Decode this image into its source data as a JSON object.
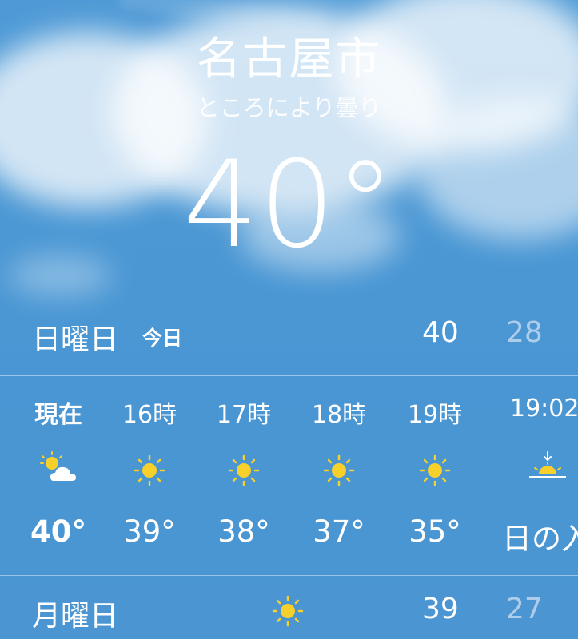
{
  "location": {
    "city": "名古屋市",
    "condition": "ところにより曇り",
    "temperature": "40°"
  },
  "today": {
    "day": "日曜日",
    "tag": "今日",
    "high": "40",
    "low": "28"
  },
  "hourly": [
    {
      "time": "現在",
      "icon": "partly-cloudy-icon",
      "temp": "40°"
    },
    {
      "time": "16時",
      "icon": "sun-icon",
      "temp": "39°"
    },
    {
      "time": "17時",
      "icon": "sun-icon",
      "temp": "38°"
    },
    {
      "time": "18時",
      "icon": "sun-icon",
      "temp": "37°"
    },
    {
      "time": "19時",
      "icon": "sun-icon",
      "temp": "35°"
    },
    {
      "time": "19:02",
      "icon": "sunset-icon",
      "temp": "日の入"
    }
  ],
  "forecast": [
    {
      "day": "月曜日",
      "icon": "sun-icon",
      "high": "39",
      "low": "27"
    }
  ],
  "colors": {
    "sky": "#4a97d4",
    "sun": "#f8d02b",
    "low_temp": "#aecdeb"
  }
}
